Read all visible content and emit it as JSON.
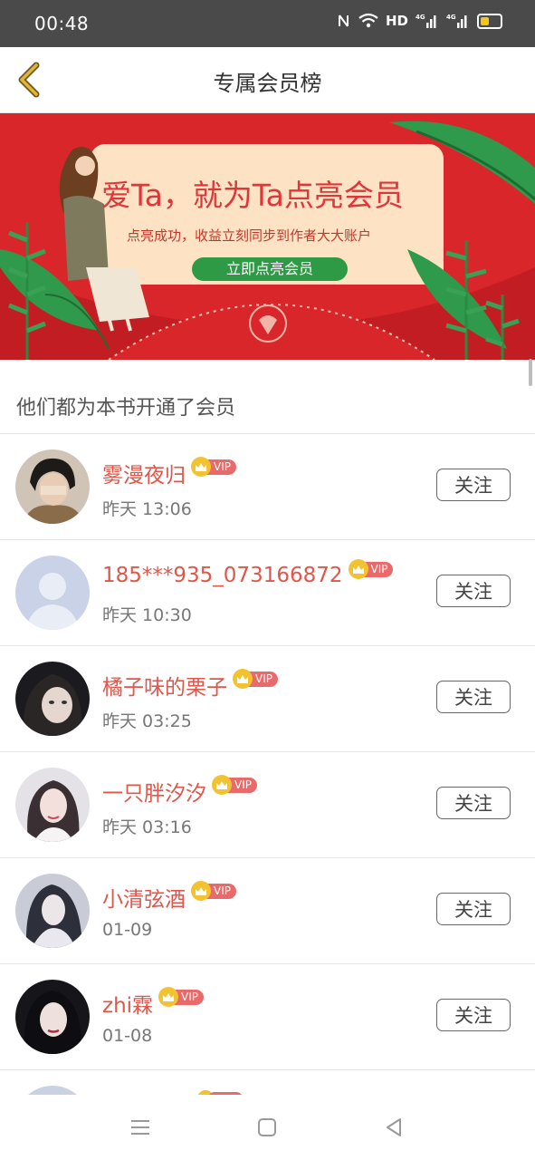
{
  "status_bar": {
    "time": "00:48",
    "icons_text": "HD"
  },
  "header": {
    "title": "专属会员榜"
  },
  "banner": {
    "headline": "爱Ta，就为Ta点亮会员",
    "subline": "点亮成功，收益立刻同步到作者大大账户",
    "button_label": "立即点亮会员",
    "colors": {
      "background": "#d8262a",
      "card": "#fde2c4",
      "button": "#2e9a45"
    }
  },
  "section": {
    "title": "他们都为本书开通了会员"
  },
  "vip_label": "VIP",
  "follow_label": "关注",
  "members": [
    {
      "name": "雾漫夜归",
      "time": "昨天 13:06",
      "avatar": "photo-dark"
    },
    {
      "name": "185***935_073166872",
      "time": "昨天 10:30",
      "avatar": "default-silhouette"
    },
    {
      "name": "橘子味的栗子",
      "time": "昨天 03:25",
      "avatar": "photo-dark"
    },
    {
      "name": "一只胖汐汐",
      "time": "昨天 03:16",
      "avatar": "photo-light"
    },
    {
      "name": "小清弦酒",
      "time": "01-09",
      "avatar": "photo-anime"
    },
    {
      "name": "zhi霖",
      "time": "01-08",
      "avatar": "photo-dark"
    }
  ],
  "colors": {
    "name": "#e0564a",
    "accent": "#f2c230"
  }
}
